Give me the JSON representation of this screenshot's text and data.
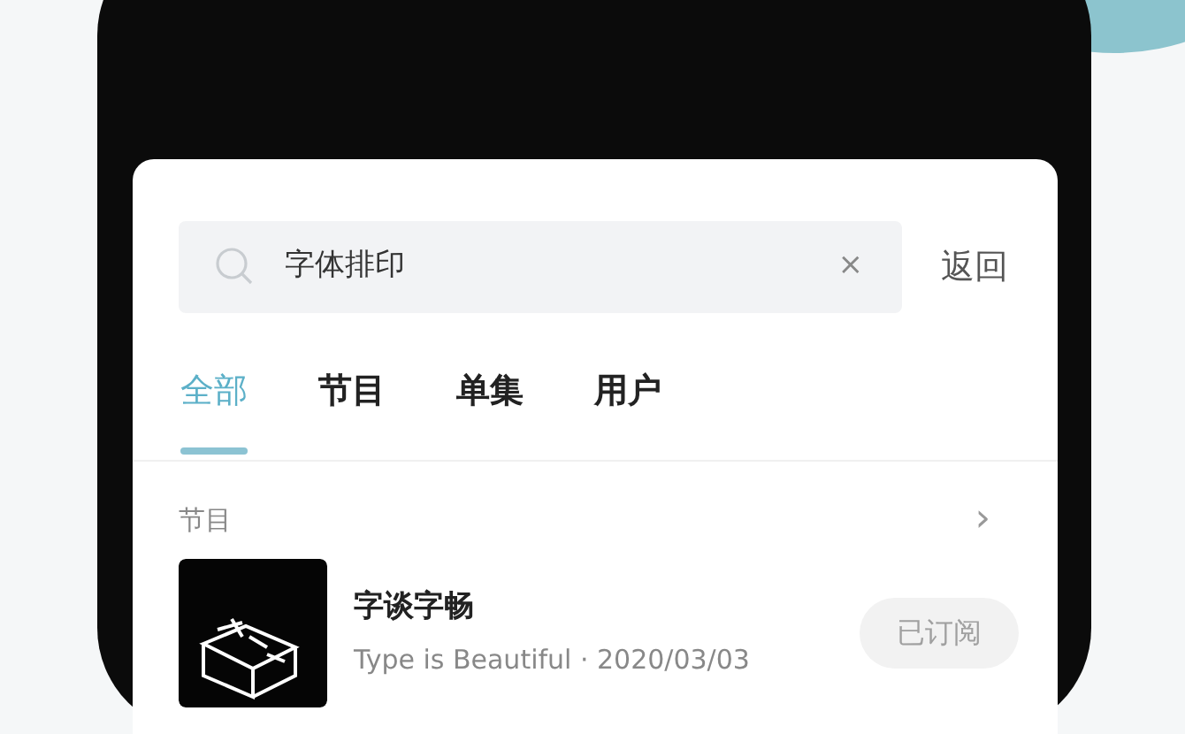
{
  "search": {
    "value": "字体排印",
    "clear": "×",
    "cancel": "返回"
  },
  "tabs": [
    {
      "label": "全部",
      "selected": true
    },
    {
      "label": "节目",
      "selected": false
    },
    {
      "label": "单集",
      "selected": false
    },
    {
      "label": "用户",
      "selected": false
    }
  ],
  "section": {
    "title": "节目",
    "more": "›",
    "items": [
      {
        "title": "字谈字畅",
        "subtitle": "Type is Beautiful · 2020/03/03",
        "button": "已订阅",
        "subscribed": true
      }
    ]
  }
}
